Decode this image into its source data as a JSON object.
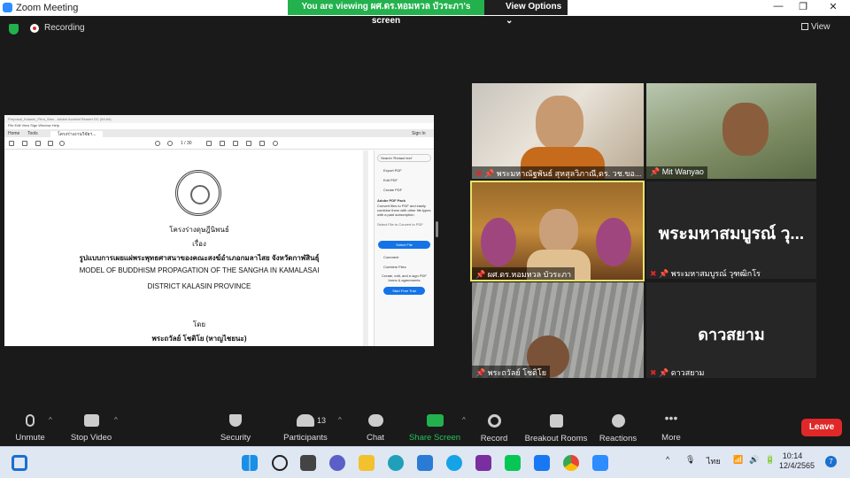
{
  "window": {
    "title": "Zoom Meeting",
    "minimize": "—",
    "maximize": "❐",
    "close": "✕"
  },
  "banner": {
    "text": "You are viewing ผศ.ดร.หอมหวล บัวระภา's screen",
    "view_options": "View Options"
  },
  "status": {
    "recording": "Recording",
    "view": "View"
  },
  "shared_screen": {
    "window_title": "Proposal_Kalasin_Phra_Wan - Adobe Acrobat Reader DC (64-bit)",
    "menu": "File   Edit   View   Sign   Window   Help",
    "tabs": [
      "Home",
      "Tools",
      "โครงร่างงานวิจัยฯ..."
    ],
    "sign_in": "Sign In",
    "page": "1 / 30",
    "doc_lines": [
      "โครงร่างดุษฎีนิพนธ์",
      "เรื่อง",
      "รูปแบบการเผยแผ่พระพุทธศาสนาของคณะสงฆ์อำเภอกมลาไสย จังหวัดกาฬสินธุ์",
      "MODEL OF BUDDHISM PROPAGATION OF THE SANGHA IN KAMALASAI",
      "DISTRICT KALASIN PROVINCE",
      "โดย",
      "พระถวัลย์  โชติโย  (หาญไชยนะ)"
    ],
    "sidebar": {
      "search": "Search 'Redact text'",
      "items": [
        "Export PDF",
        "Edit PDF",
        "Create PDF"
      ],
      "pack_title": "Adobe PDF Pack",
      "pack_text": "Convert files to PDF and easily combine them with other file types with a paid subscription",
      "select_hint": "Select File to Convert to PDF",
      "select_button": "Select File",
      "items2": [
        "Comment",
        "Combine Files"
      ],
      "promo": "Create, edit, and e-sign PDF forms & agreements",
      "trial_button": "Start Free Trial"
    }
  },
  "participants_tiles": [
    {
      "name": "พระมหาณัฐพันธ์ สุหสุลวิภาณี,ดร. วช.ขอ...",
      "muted": true
    },
    {
      "name": "Mit Wanyao",
      "muted": false
    },
    {
      "name": "ผศ.ดร.หอมหวล บัวระภา",
      "muted": false,
      "active": true
    },
    {
      "name": "พระมหาสมบูรณ์ วุฑฒิกโร",
      "big": "พระมหาสมบูรณ์ วุ...",
      "muted": true
    },
    {
      "name": "พระถวัลย์ โชติโย",
      "muted": false
    },
    {
      "name": "ดาวสยาม",
      "big": "ดาวสยาม",
      "muted": true
    }
  ],
  "toolbar": {
    "unmute": "Unmute",
    "stop_video": "Stop Video",
    "security": "Security",
    "participants": "Participants",
    "participants_count": "13",
    "chat": "Chat",
    "share_screen": "Share Screen",
    "record": "Record",
    "breakout": "Breakout Rooms",
    "reactions": "Reactions",
    "more": "More",
    "leave": "Leave"
  },
  "taskbar": {
    "lang": "ไทย",
    "time": "10:14",
    "date": "12/4/2565",
    "notif": "7"
  },
  "colors": {
    "zoom_blue": "#2D8CFF",
    "banner_green": "#23b14d",
    "leave_red": "#e02828",
    "active_border": "#e7e36a"
  }
}
